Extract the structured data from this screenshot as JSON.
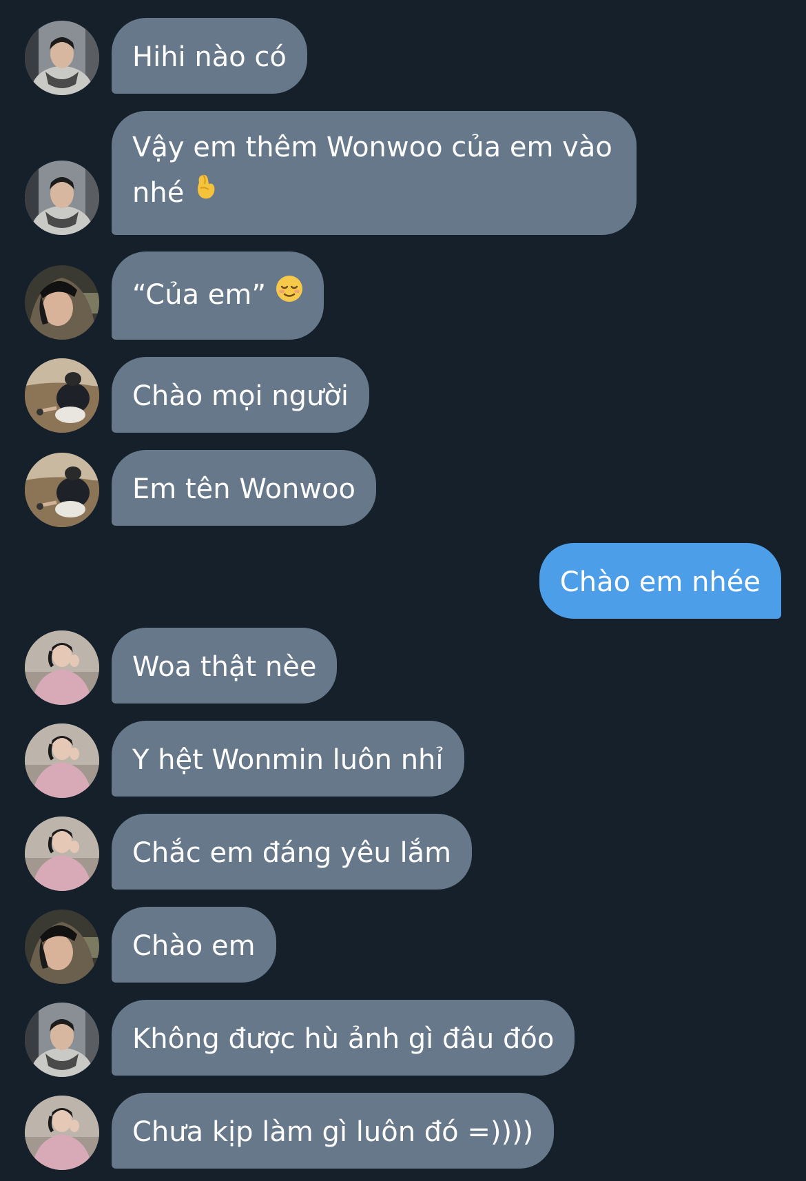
{
  "conversation": {
    "messages": [
      {
        "sender": "user_a",
        "avatar": "avatar-scarf",
        "text": "Hihi nào có"
      },
      {
        "sender": "user_a",
        "avatar": "avatar-scarf",
        "text": "Vậy em thêm Wonwoo của em vào nhé",
        "emoji": "pinched-fingers-emoji"
      },
      {
        "sender": "user_b",
        "avatar": "avatar-hood",
        "text": "“Của em”",
        "emoji": "relieved-face-emoji"
      },
      {
        "sender": "user_c",
        "avatar": "avatar-crouch",
        "text": "Chào mọi người"
      },
      {
        "sender": "user_c",
        "avatar": "avatar-crouch",
        "text": "Em tên Wonwoo"
      },
      {
        "sender": "me",
        "text": "Chào em nhée"
      },
      {
        "sender": "user_d",
        "avatar": "avatar-pink",
        "text": "Woa thật nèe"
      },
      {
        "sender": "user_d",
        "avatar": "avatar-pink",
        "text": "Y hệt Wonmin luôn nhỉ"
      },
      {
        "sender": "user_d",
        "avatar": "avatar-pink",
        "text": "Chắc em đáng yêu lắm"
      },
      {
        "sender": "user_b",
        "avatar": "avatar-hood",
        "text": "Chào em"
      },
      {
        "sender": "user_a",
        "avatar": "avatar-scarf",
        "text": "Không được hù ảnh gì đâu đóo"
      },
      {
        "sender": "user_d",
        "avatar": "avatar-pink",
        "text": "Chưa kịp làm gì luôn đó =))))"
      }
    ]
  },
  "colors": {
    "background": "#15202b",
    "incoming_bubble": "#66788a",
    "outgoing_bubble": "#4d9ee8",
    "text": "#ffffff"
  }
}
